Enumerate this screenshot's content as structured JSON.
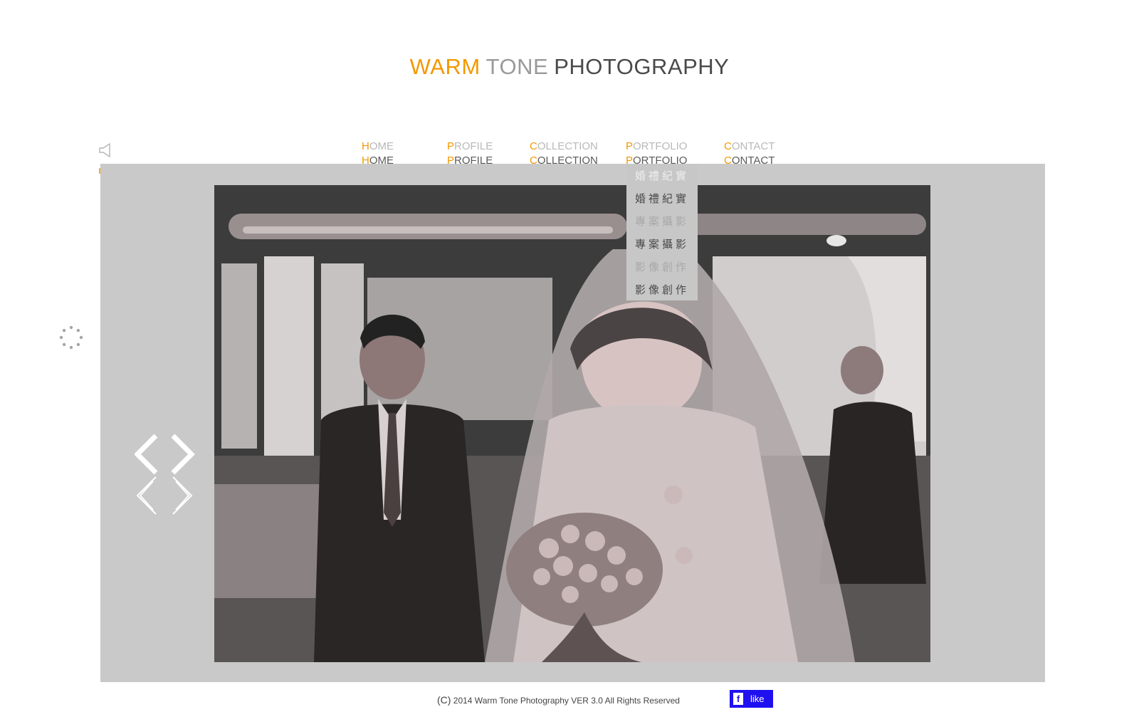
{
  "logo": {
    "word1": "WARM",
    "word2": "TONE",
    "word3": "PHOTOGRAPHY"
  },
  "colors": {
    "accent": "#f39800",
    "stage_bg": "#c9c9c9",
    "text_dark": "#4a4a4a",
    "fb_blue": "#1f10f0"
  },
  "sound": {
    "off_icon": "speaker-off-icon",
    "on_icon": "speaker-on-icon"
  },
  "nav": {
    "home": {
      "initial": "H",
      "rest": "OME"
    },
    "profile": {
      "initial": "P",
      "rest": "ROFILE"
    },
    "collection": {
      "initial": "C",
      "rest": "OLLECTION"
    },
    "portfolio": {
      "initial": "P",
      "rest": "ORTFOLIO"
    },
    "contact": {
      "initial": "C",
      "rest": "ONTACT"
    }
  },
  "dropdown": {
    "items": [
      "婚禮紀實",
      "專案攝影",
      "影像創作"
    ]
  },
  "slideshow": {
    "loading_icon": "loading-spinner-icon",
    "prev_icon": "chevron-left-icon",
    "next_icon": "chevron-right-icon"
  },
  "footer": {
    "copyright_symbol": "(C)",
    "text": "2014 Warm Tone Photography VER 3.0  All Rights Reserved"
  },
  "facebook": {
    "f": "f",
    "label": "like"
  }
}
